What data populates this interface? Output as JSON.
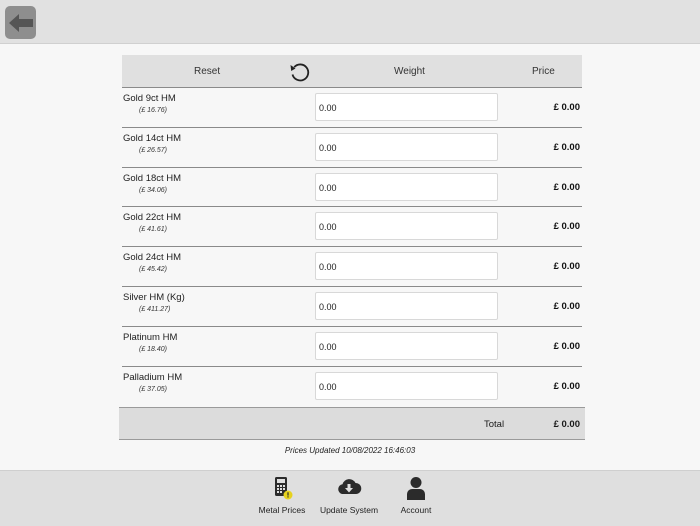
{
  "header": {
    "back_icon": "back-arrow-icon"
  },
  "table": {
    "headers": {
      "reset": "Reset",
      "weight": "Weight",
      "price": "Price"
    },
    "rows": [
      {
        "name": "Gold 9ct HM",
        "unit_price": "(£ 16.76)",
        "weight": "0.00",
        "price": "£ 0.00"
      },
      {
        "name": "Gold 14ct HM",
        "unit_price": "(£ 26.57)",
        "weight": "0.00",
        "price": "£ 0.00"
      },
      {
        "name": "Gold 18ct HM",
        "unit_price": "(£ 34.06)",
        "weight": "0.00",
        "price": "£ 0.00"
      },
      {
        "name": "Gold 22ct HM",
        "unit_price": "(£ 41.61)",
        "weight": "0.00",
        "price": "£ 0.00"
      },
      {
        "name": "Gold 24ct HM",
        "unit_price": "(£ 45.42)",
        "weight": "0.00",
        "price": "£ 0.00"
      },
      {
        "name": "Silver HM (Kg)",
        "unit_price": "(£ 411.27)",
        "weight": "0.00",
        "price": "£ 0.00"
      },
      {
        "name": "Platinum HM",
        "unit_price": "(£ 18.40)",
        "weight": "0.00",
        "price": "£ 0.00"
      },
      {
        "name": "Palladium HM",
        "unit_price": "(£ 37.05)",
        "weight": "0.00",
        "price": "£ 0.00"
      }
    ],
    "total_label": "Total",
    "total_value": "£ 0.00"
  },
  "status": {
    "updated": "Prices Updated 10/08/2022 16:46:03"
  },
  "nav": {
    "metal_prices": "Metal Prices",
    "update_system": "Update System",
    "account": "Account"
  },
  "colors": {
    "back_button": "#8e8e8e",
    "warning_badge": "#e6d21e",
    "icon_dark": "#2b2b2b"
  }
}
